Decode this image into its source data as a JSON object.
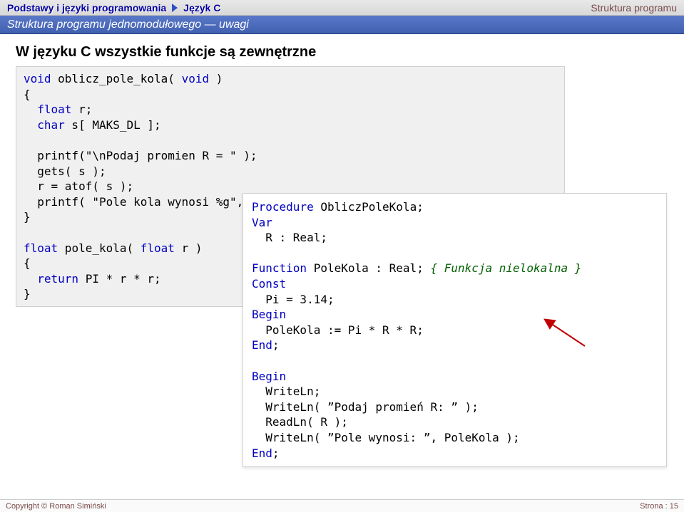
{
  "header": {
    "crumb1": "Podstawy i języki programowania",
    "crumb2": "Język C",
    "right": "Struktura programu"
  },
  "subheader": "Struktura programu jednomodułowego — uwagi",
  "title": "W języku C wszystkie funkcje są zewnętrzne",
  "c_code": {
    "l1a": "void",
    "l1b": " oblicz_pole_kola( ",
    "l1c": "void",
    "l1d": " )",
    "l2": "{",
    "l3a": "  ",
    "l3b": "float",
    "l3c": " r;",
    "l4a": "  ",
    "l4b": "char",
    "l4c": " s[ MAKS_DL ];",
    "l5": "",
    "l6": "  printf(\"\\nPodaj promien R = \" );",
    "l7": "  gets( s );",
    "l8": "  r = atof( s );",
    "l9": "  printf( \"Pole kola wynosi %g\", pole_kola( r ) );",
    "l10": "}",
    "l11": "",
    "l12a": "float",
    "l12b": " pole_kola( ",
    "l12c": "float",
    "l12d": " r )",
    "l13": "{",
    "l14a": "  ",
    "l14b": "return",
    "l14c": " PI * r * r;",
    "l15": "}"
  },
  "pascal_code": {
    "l1a": "Procedure",
    "l1b": " ObliczPoleKola;",
    "l2a": "Var",
    "l3": "  R : Real;",
    "l4": "",
    "l5a": "Function",
    "l5b": " PoleKola : Real; ",
    "l5c": "{ Funkcja nielokalna }",
    "l6a": "Const",
    "l7": "  Pi = 3.14;",
    "l8a": "Begin",
    "l9": "  PoleKola := Pi * R * R;",
    "l10a": "End",
    "l10b": ";",
    "l11": "",
    "l12a": "Begin",
    "l13": "  WriteLn;",
    "l14": "  WriteLn( ”Podaj promień R: ” );",
    "l15": "  ReadLn( R );",
    "l16": "  WriteLn( ”Pole wynosi: ”, PoleKola );",
    "l17a": "End",
    "l17b": ";"
  },
  "footer": {
    "left": "Copyright © Roman Simiński",
    "right": "Strona : 15"
  }
}
